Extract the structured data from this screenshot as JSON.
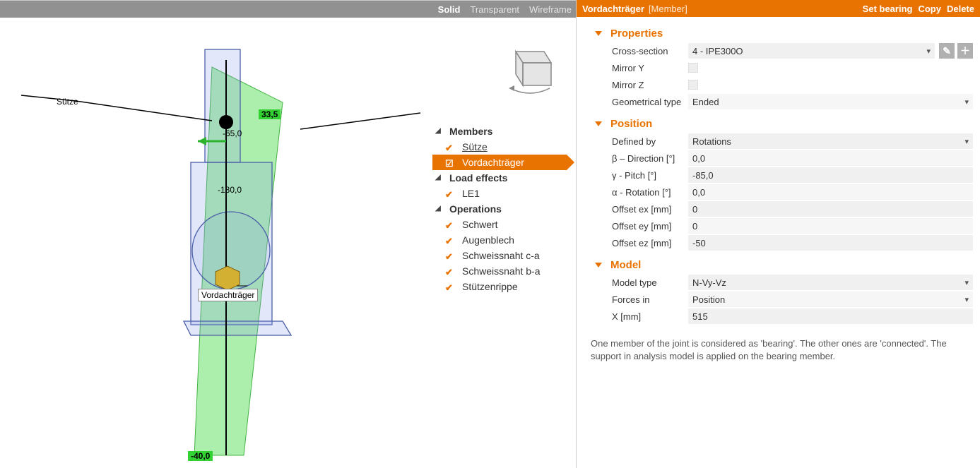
{
  "view_modes": {
    "solid": "Solid",
    "transparent": "Transparent",
    "wireframe": "Wireframe",
    "active": "solid"
  },
  "scene_labels": {
    "stutze": "Sütze",
    "vordach": "Vordachträger",
    "val_335": "33,5",
    "val_m65": "-65,0",
    "val_m180": "-180,0",
    "val_m40": "-40,0"
  },
  "tree": {
    "members_hdr": "Members",
    "members": [
      {
        "label": "Sütze",
        "selected": false,
        "underline": true
      },
      {
        "label": "Vordachträger",
        "selected": true
      }
    ],
    "loadeffects_hdr": "Load effects",
    "loadeffects": [
      {
        "label": "LE1"
      }
    ],
    "operations_hdr": "Operations",
    "operations": [
      {
        "label": "Schwert"
      },
      {
        "label": "Augenblech"
      },
      {
        "label": "Schweissnaht c-a"
      },
      {
        "label": "Schweissnaht b-a"
      },
      {
        "label": "Stützenrippe"
      }
    ]
  },
  "rp_header": {
    "title": "Vordachträger",
    "subtype": "[Member]",
    "set_bearing": "Set bearing",
    "copy": "Copy",
    "delete": "Delete"
  },
  "groups": {
    "properties": {
      "title": "Properties",
      "cross_section_label": "Cross-section",
      "cross_section_value": "4 - IPE300O",
      "mirror_y_label": "Mirror Y",
      "mirror_z_label": "Mirror Z",
      "geom_type_label": "Geometrical type",
      "geom_type_value": "Ended"
    },
    "position": {
      "title": "Position",
      "defined_by_label": "Defined by",
      "defined_by_value": "Rotations",
      "beta_label": "β – Direction [°]",
      "beta_value": "0,0",
      "gamma_label": "γ - Pitch [°]",
      "gamma_value": "-85,0",
      "alpha_label": "α - Rotation [°]",
      "alpha_value": "0,0",
      "ex_label": "Offset ex [mm]",
      "ex_value": "0",
      "ey_label": "Offset ey [mm]",
      "ey_value": "0",
      "ez_label": "Offset ez [mm]",
      "ez_value": "-50"
    },
    "model": {
      "title": "Model",
      "model_type_label": "Model type",
      "model_type_value": "N-Vy-Vz",
      "forces_in_label": "Forces in",
      "forces_in_value": "Position",
      "x_label": "X [mm]",
      "x_value": "515"
    }
  },
  "help_text": "One member of the joint is considered as 'bearing'. The other ones are 'connected'. The support in analysis model is applied on the bearing member."
}
